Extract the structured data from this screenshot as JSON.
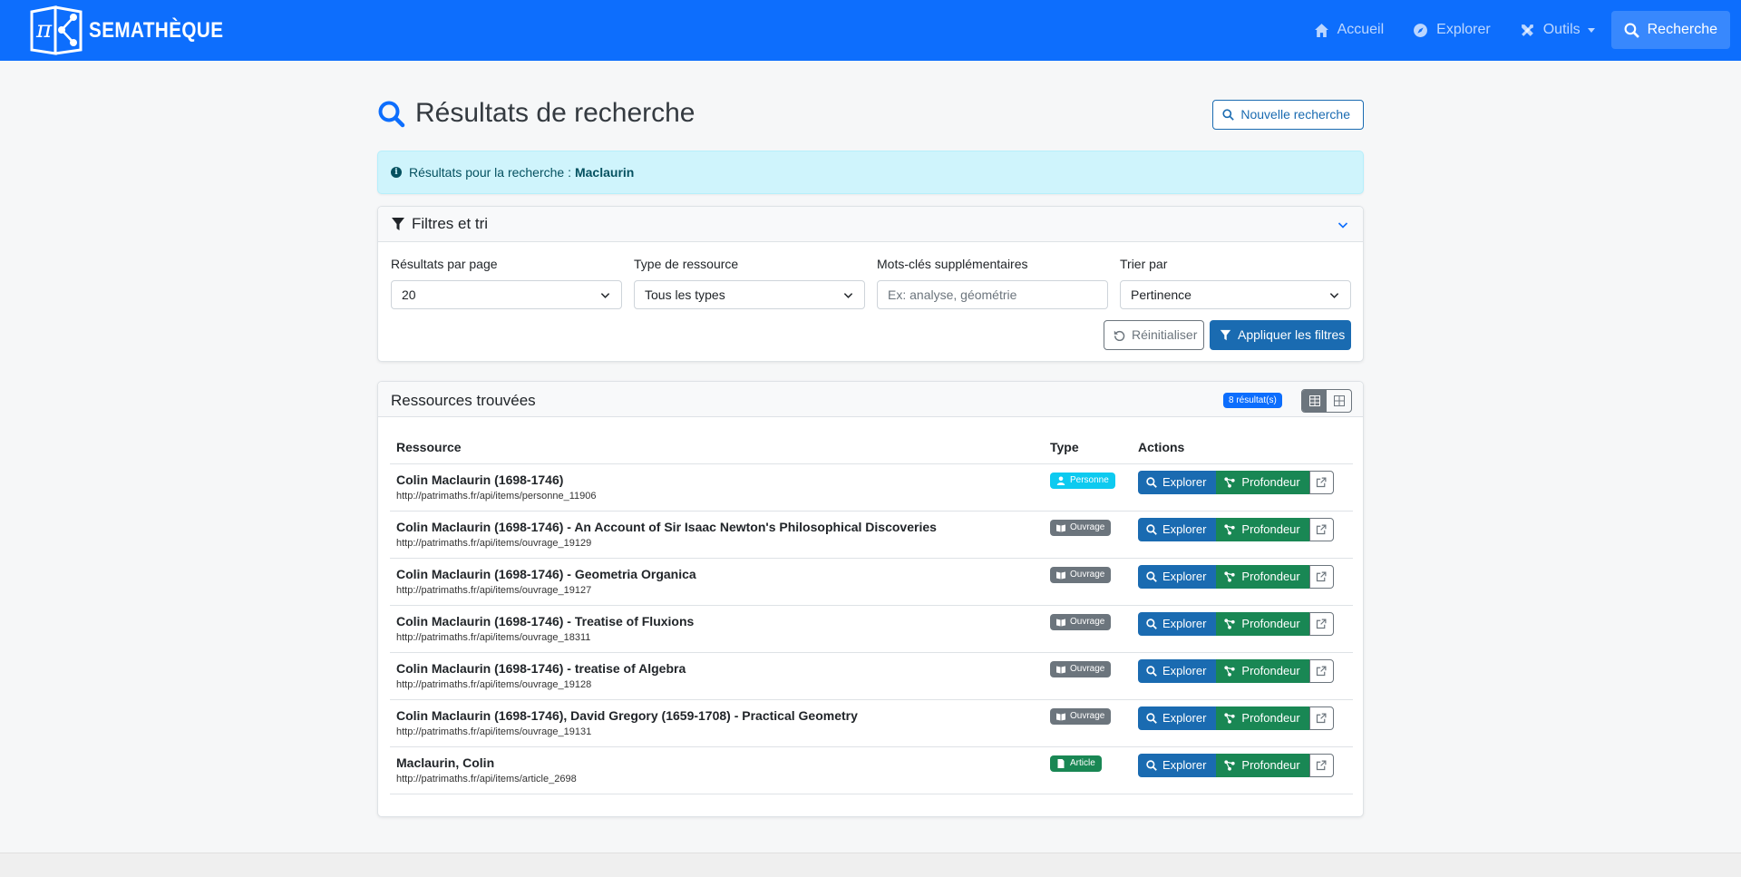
{
  "navbar": {
    "brand_name": "SEMATHÈQUE",
    "items": [
      {
        "label": "Accueil",
        "icon": "home-icon"
      },
      {
        "label": "Explorer",
        "icon": "compass-icon"
      },
      {
        "label": "Outils",
        "icon": "tools-icon"
      },
      {
        "label": "Recherche",
        "icon": "search-icon"
      }
    ],
    "bg_color": "#0d6efd"
  },
  "header": {
    "title": "Résultats de recherche",
    "new_search_label": "Nouvelle recherche"
  },
  "alert": {
    "text": "Résultats pour la recherche :",
    "query": "Maclaurin"
  },
  "filters": {
    "title": "Filtres et tri",
    "per_page_label": "Résultats par page",
    "per_page_value": "20",
    "type_label": "Type de ressource",
    "type_value": "Tous les types",
    "keywords_label": "Mots-clés supplémentaires",
    "keywords_placeholder": "Ex: analyse, géométrie",
    "sort_label": "Trier par",
    "sort_value": "Pertinence",
    "reset_label": "Réinitialiser",
    "apply_label": "Appliquer les filtres"
  },
  "results": {
    "title": "Ressources trouvées",
    "count_badge": "8 résultat(s)",
    "columns": {
      "resource": "Ressource",
      "type": "Type",
      "actions": "Actions"
    },
    "action_labels": {
      "explore": "Explorer",
      "depth": "Profondeur"
    },
    "rows": [
      {
        "name": "Colin Maclaurin (1698-1746)",
        "url": "http://patrimaths.fr/api/items/personne_11906",
        "type": "Personne"
      },
      {
        "name": "Colin Maclaurin (1698-1746) - An Account of Sir Isaac Newton's Philosophical Discoveries",
        "url": "http://patrimaths.fr/api/items/ouvrage_19129",
        "type": "Ouvrage"
      },
      {
        "name": "Colin Maclaurin (1698-1746) - Geometria Organica",
        "url": "http://patrimaths.fr/api/items/ouvrage_19127",
        "type": "Ouvrage"
      },
      {
        "name": "Colin Maclaurin (1698-1746) - Treatise of Fluxions",
        "url": "http://patrimaths.fr/api/items/ouvrage_18311",
        "type": "Ouvrage"
      },
      {
        "name": "Colin Maclaurin (1698-1746) - treatise of Algebra",
        "url": "http://patrimaths.fr/api/items/ouvrage_19128",
        "type": "Ouvrage"
      },
      {
        "name": "Colin Maclaurin (1698-1746), David Gregory (1659-1708) - Practical Geometry",
        "url": "http://patrimaths.fr/api/items/ouvrage_19131",
        "type": "Ouvrage"
      },
      {
        "name": "Maclaurin, Colin",
        "url": "http://patrimaths.fr/api/items/article_2698",
        "type": "Article"
      }
    ]
  }
}
